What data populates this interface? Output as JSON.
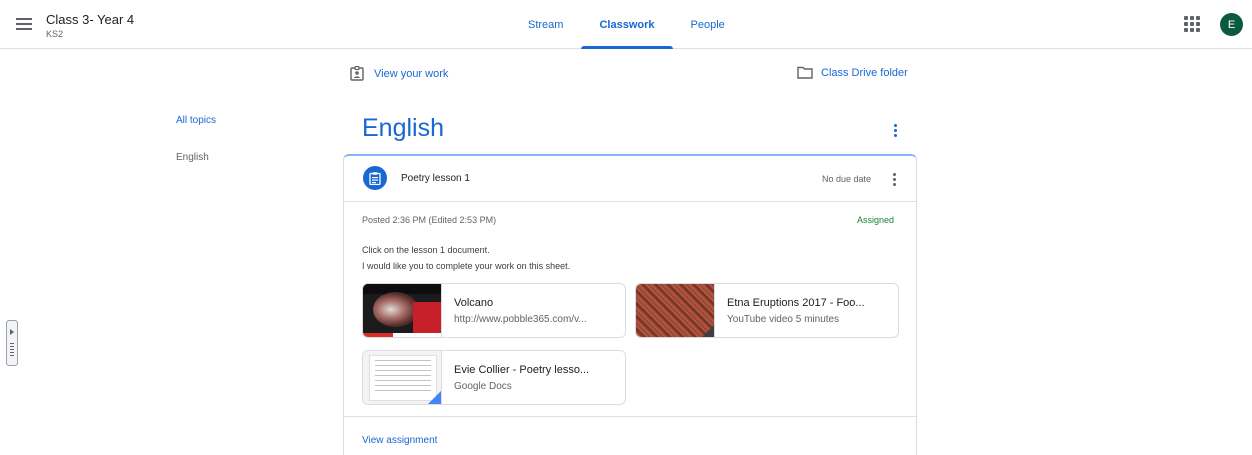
{
  "header": {
    "class_title": "Class 3- Year 4",
    "class_subtitle": "KS2",
    "avatar_letter": "E",
    "tabs": [
      {
        "label": "Stream"
      },
      {
        "label": "Classwork"
      },
      {
        "label": "People"
      }
    ],
    "active_tab": "Classwork"
  },
  "actions": {
    "view_your_work": "View your work",
    "class_drive_folder": "Class Drive folder"
  },
  "topics": {
    "all": "All topics",
    "items": [
      "English"
    ]
  },
  "section": {
    "title": "English"
  },
  "assignment": {
    "title": "Poetry lesson 1",
    "due": "No due date",
    "posted": "Posted 2:36 PM (Edited 2:53 PM)",
    "status": "Assigned",
    "description_lines": [
      "Click on the lesson 1 document.",
      "I would like you to complete your work on this sheet."
    ],
    "attachments": [
      {
        "title": "Volcano",
        "subtitle": "http://www.pobble365.com/v..."
      },
      {
        "title": "Etna Eruptions 2017 - Foo...",
        "subtitle": "YouTube video  5 minutes"
      },
      {
        "title": "Evie Collier - Poetry lesso...",
        "subtitle": "Google Docs"
      }
    ],
    "view_assignment": "View assignment"
  },
  "colors": {
    "accent": "#1967d2",
    "assigned": "#188038",
    "avatar_bg": "#0b5a3d"
  }
}
